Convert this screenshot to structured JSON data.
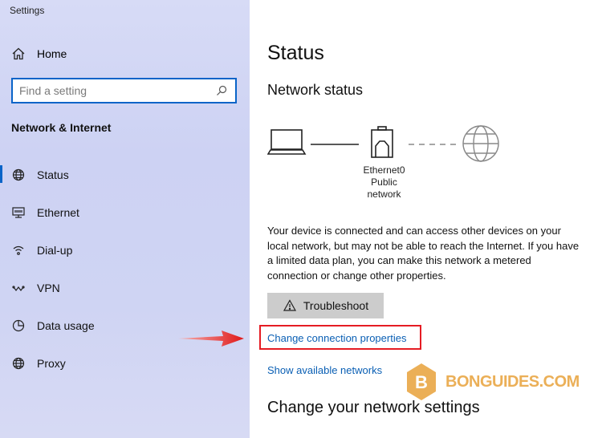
{
  "app": {
    "title": "Settings"
  },
  "sidebar": {
    "home_label": "Home",
    "search_placeholder": "Find a setting",
    "section_title": "Network & Internet",
    "items": [
      {
        "label": "Status",
        "icon": "globe-icon",
        "active": true
      },
      {
        "label": "Ethernet",
        "icon": "ethernet-icon",
        "active": false
      },
      {
        "label": "Dial-up",
        "icon": "dialup-icon",
        "active": false
      },
      {
        "label": "VPN",
        "icon": "vpn-icon",
        "active": false
      },
      {
        "label": "Data usage",
        "icon": "data-usage-icon",
        "active": false
      },
      {
        "label": "Proxy",
        "icon": "globe-icon",
        "active": false
      }
    ]
  },
  "main": {
    "title": "Status",
    "network_status_heading": "Network status",
    "adapter_name": "Ethernet0",
    "network_type": "Public network",
    "description": "Your device is connected and can access other devices on your local network, but may not be able to reach the Internet. If you have a limited data plan, you can make this network a metered connection or change other properties.",
    "troubleshoot_label": "Troubleshoot",
    "change_connection_label": "Change connection properties",
    "show_networks_label": "Show available networks",
    "change_settings_heading": "Change your network settings"
  },
  "watermark": {
    "text": "BONGUIDES.COM",
    "letter": "B"
  },
  "colors": {
    "accent": "#0a64c8",
    "link": "#0a5fb4",
    "highlight": "#e51c23",
    "watermark": "#e8a23a"
  }
}
